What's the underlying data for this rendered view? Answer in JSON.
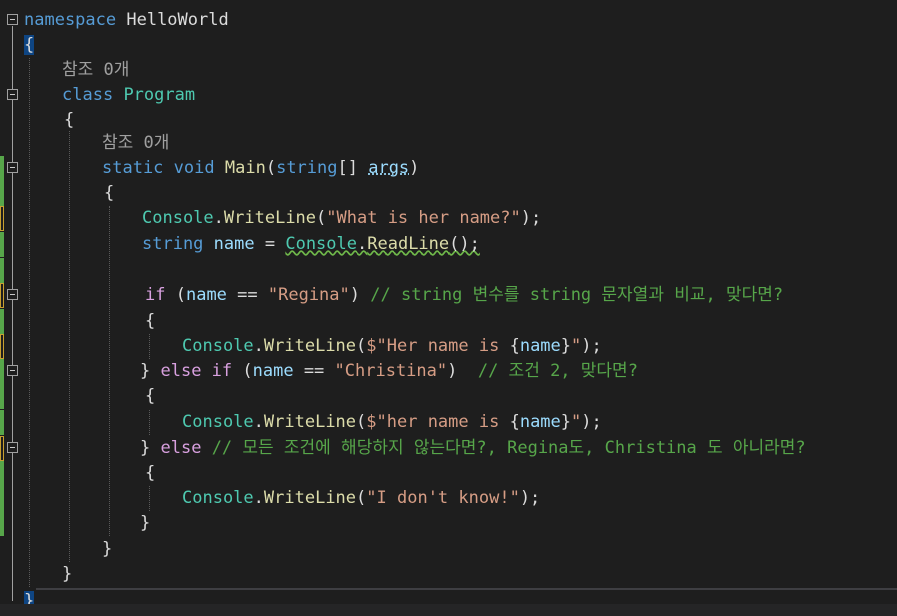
{
  "editor": {
    "lines": [
      {
        "segments": [
          [
            "kw",
            "namespace"
          ],
          [
            "punc",
            " HelloWorld"
          ]
        ]
      },
      {
        "segments": [
          [
            "punc",
            "{"
          ]
        ]
      },
      {
        "segments": [
          [
            "ref",
            "참조 0개"
          ]
        ]
      },
      {
        "segments": [
          [
            "kw",
            "class"
          ],
          [
            "punc",
            " "
          ],
          [
            "cls",
            "Program"
          ]
        ]
      },
      {
        "segments": [
          [
            "punc",
            "{"
          ]
        ]
      },
      {
        "segments": [
          [
            "ref",
            "참조 0개"
          ]
        ]
      },
      {
        "segments": [
          [
            "kw",
            "static"
          ],
          [
            "punc",
            " "
          ],
          [
            "kw",
            "void"
          ],
          [
            "punc",
            " "
          ],
          [
            "mth",
            "Main"
          ],
          [
            "punc",
            "("
          ],
          [
            "kw",
            "string"
          ],
          [
            "punc",
            "[] "
          ],
          [
            "var",
            "args"
          ],
          [
            "punc",
            ")"
          ]
        ]
      },
      {
        "segments": [
          [
            "punc",
            "{"
          ]
        ]
      },
      {
        "segments": [
          [
            "cls",
            "Console"
          ],
          [
            "punc",
            "."
          ],
          [
            "mth",
            "WriteLine"
          ],
          [
            "punc",
            "("
          ],
          [
            "str",
            "\"What is her name?\""
          ],
          [
            "punc",
            ");"
          ]
        ]
      },
      {
        "segments": [
          [
            "kw",
            "string"
          ],
          [
            "punc",
            " "
          ],
          [
            "var",
            "name"
          ],
          [
            "punc",
            " = "
          ],
          [
            "cls",
            "Console"
          ],
          [
            "punc",
            "."
          ],
          [
            "mth",
            "ReadLine"
          ],
          [
            "punc",
            "();"
          ]
        ]
      },
      {
        "segments": []
      },
      {
        "segments": [
          [
            "ctrl",
            "if"
          ],
          [
            "punc",
            " ("
          ],
          [
            "var",
            "name"
          ],
          [
            "punc",
            " == "
          ],
          [
            "str",
            "\"Regina\""
          ],
          [
            "punc",
            ") "
          ],
          [
            "cmt",
            "// string 변수를 string 문자열과 비교, 맞다면?"
          ]
        ]
      },
      {
        "segments": [
          [
            "punc",
            "{"
          ]
        ]
      },
      {
        "segments": [
          [
            "cls",
            "Console"
          ],
          [
            "punc",
            "."
          ],
          [
            "mth",
            "WriteLine"
          ],
          [
            "punc",
            "("
          ],
          [
            "str",
            "$\"Her name is "
          ],
          [
            "punc",
            "{"
          ],
          [
            "var",
            "name"
          ],
          [
            "punc",
            "}"
          ],
          [
            "str",
            "\""
          ],
          [
            "punc",
            ");"
          ]
        ]
      },
      {
        "segments": [
          [
            "punc",
            "} "
          ],
          [
            "ctrl",
            "else if"
          ],
          [
            "punc",
            " ("
          ],
          [
            "var",
            "name"
          ],
          [
            "punc",
            " == "
          ],
          [
            "str",
            "\"Christina\""
          ],
          [
            "punc",
            ")  "
          ],
          [
            "cmt",
            "// 조건 2, 맞다면?"
          ]
        ]
      },
      {
        "segments": [
          [
            "punc",
            "{"
          ]
        ]
      },
      {
        "segments": [
          [
            "cls",
            "Console"
          ],
          [
            "punc",
            "."
          ],
          [
            "mth",
            "WriteLine"
          ],
          [
            "punc",
            "("
          ],
          [
            "str",
            "$\"her name is "
          ],
          [
            "punc",
            "{"
          ],
          [
            "var",
            "name"
          ],
          [
            "punc",
            "}"
          ],
          [
            "str",
            "\""
          ],
          [
            "punc",
            ");"
          ]
        ]
      },
      {
        "segments": [
          [
            "punc",
            "} "
          ],
          [
            "ctrl",
            "else"
          ],
          [
            "punc",
            " "
          ],
          [
            "cmt",
            "// 모든 조건에 해당하지 않는다면?, Regina도, Christina 도 아니라면?"
          ]
        ]
      },
      {
        "segments": [
          [
            "punc",
            "{"
          ]
        ]
      },
      {
        "segments": [
          [
            "cls",
            "Console"
          ],
          [
            "punc",
            "."
          ],
          [
            "mth",
            "WriteLine"
          ],
          [
            "punc",
            "("
          ],
          [
            "str",
            "\"I don't know!\""
          ],
          [
            "punc",
            ");"
          ]
        ]
      },
      {
        "segments": [
          [
            "punc",
            "}"
          ]
        ]
      },
      {
        "segments": [
          [
            "punc",
            "}"
          ]
        ]
      },
      {
        "segments": [
          [
            "punc",
            "}"
          ]
        ]
      },
      {
        "segments": [
          [
            "punc",
            "}"
          ]
        ]
      }
    ]
  },
  "colors": {
    "background": "#1e1e1e",
    "keyword": "#569cd6",
    "class": "#4ec9b0",
    "string": "#d69d85",
    "comment": "#57a64a",
    "method": "#dcdcaa",
    "control": "#d8a0df",
    "variable": "#9cdcfe"
  },
  "icons": {
    "fold": "collapse-minus-icon"
  }
}
